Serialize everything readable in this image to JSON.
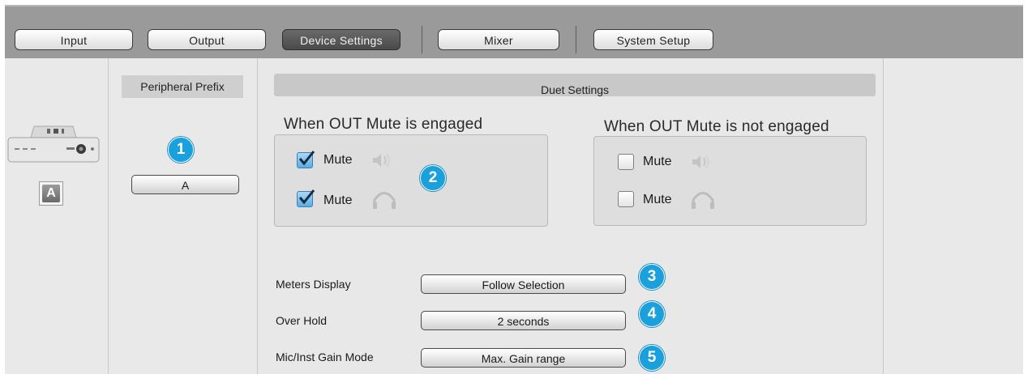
{
  "toolbar": {
    "tabs": [
      {
        "label": "Input"
      },
      {
        "label": "Output"
      },
      {
        "label": "Device Settings"
      },
      {
        "label": "Mixer"
      },
      {
        "label": "System Setup"
      }
    ],
    "active_tab": "Device Settings"
  },
  "device": {
    "prefix_badge": "A"
  },
  "peripheral": {
    "title": "Peripheral Prefix",
    "prefix_value": "A",
    "badge": "1"
  },
  "duet": {
    "title": "Duet Settings",
    "engaged": {
      "title": "When OUT Mute is engaged",
      "speaker_mute": {
        "label": "Mute",
        "checked": true
      },
      "headphone_mute": {
        "label": "Mute",
        "checked": true
      }
    },
    "not_engaged": {
      "title": "When OUT Mute is not engaged",
      "speaker_mute": {
        "label": "Mute",
        "checked": false
      },
      "headphone_mute": {
        "label": "Mute",
        "checked": false
      }
    },
    "badge": "2"
  },
  "settings": [
    {
      "label": "Meters Display",
      "value": "Follow Selection",
      "badge": "3"
    },
    {
      "label": "Over Hold",
      "value": "2 seconds",
      "badge": "4"
    },
    {
      "label": "Mic/Inst Gain Mode",
      "value": "Max. Gain range",
      "badge": "5"
    }
  ],
  "colors": {
    "accent_badge": "#1aa0dc",
    "toolbar": "#9a9a9a",
    "panel": "#e8e8e8"
  }
}
